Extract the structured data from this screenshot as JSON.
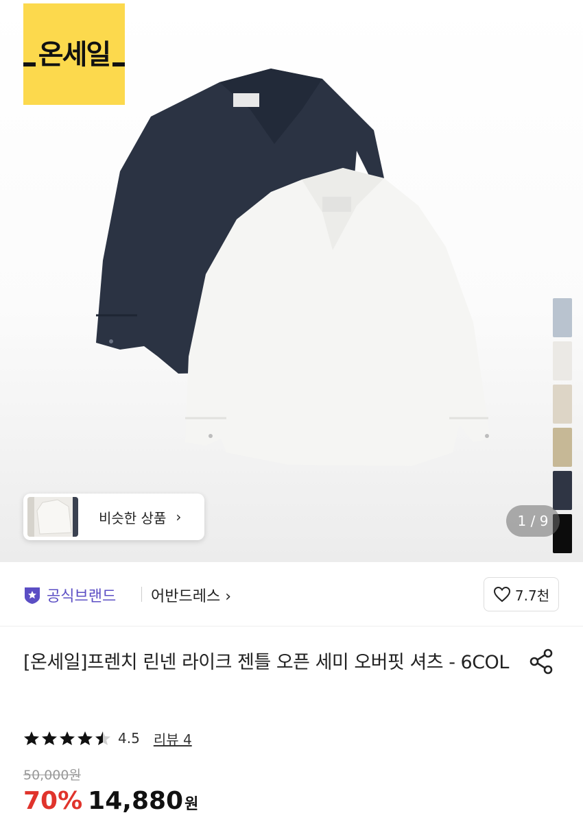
{
  "badge": {
    "text": "온세일",
    "color": "#fcd94d"
  },
  "gallery": {
    "swatch_colors": [
      "#b9c3cf",
      "#ebe9e5",
      "#ddd5c6",
      "#c6b896",
      "#2f3544",
      "#0c0c0c"
    ],
    "similar_label": "비슷한 상품",
    "similar_chevron": "›",
    "counter": "1 / 9"
  },
  "brand": {
    "official_label": "공식브랜드",
    "official_color": "#5b4ec4",
    "name": "어반드레스 ›",
    "likes": "7.7천"
  },
  "product": {
    "title": "[온세일]프렌치 린넨 라이크 젠틀 오픈 세미 오버핏 셔츠 - 6COL",
    "rating": "4.5",
    "rating_stars": 4.5,
    "reviews": "리뷰 4",
    "original_price": "50,000원",
    "discount": "70%",
    "price": "14,880",
    "currency": "원",
    "discount_color": "#e0342c"
  },
  "icons": {
    "heart": "heart-icon",
    "share": "share-icon",
    "shield": "shield-star-icon",
    "star": "star-icon"
  }
}
